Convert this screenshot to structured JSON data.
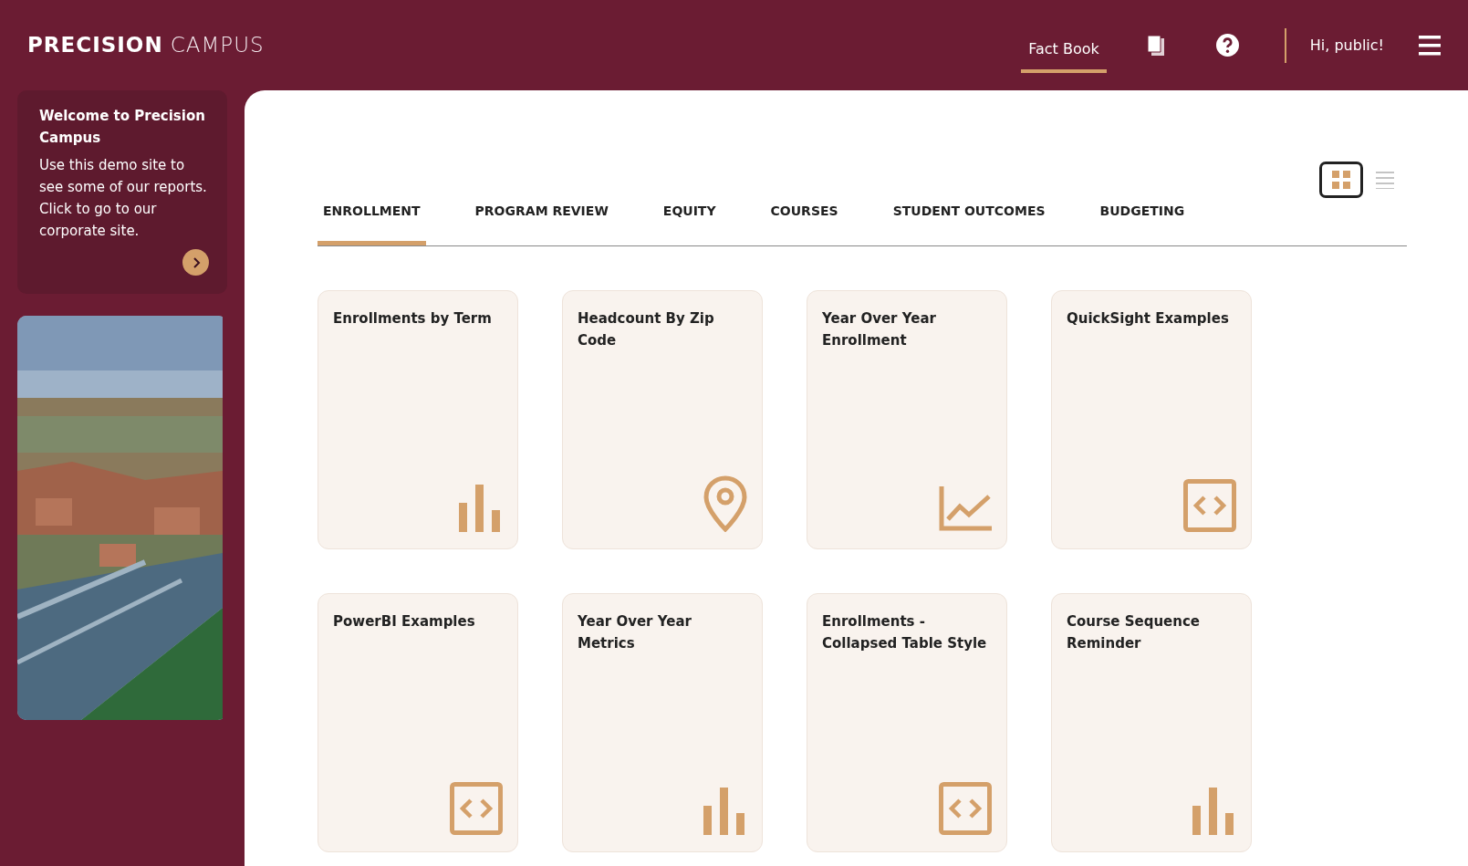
{
  "header": {
    "logo": {
      "bold": "PRECISION",
      "light": "CAMPUS"
    },
    "nav": [
      {
        "label": "Fact Book",
        "selected": true
      }
    ],
    "greeting": "Hi, public!"
  },
  "welcome": {
    "title": "Welcome to Precision Campus",
    "text": "Use this demo site to see some of our reports. Click to go to our corporate site."
  },
  "view_toggle": [
    {
      "kind": "grid",
      "selected": true
    },
    {
      "kind": "list",
      "selected": false
    }
  ],
  "tabs": [
    {
      "label": "ENROLLMENT",
      "selected": true
    },
    {
      "label": "PROGRAM REVIEW",
      "selected": false
    },
    {
      "label": "EQUITY",
      "selected": false
    },
    {
      "label": "COURSES",
      "selected": false
    },
    {
      "label": "STUDENT OUTCOMES",
      "selected": false
    },
    {
      "label": "BUDGETING",
      "selected": false
    }
  ],
  "cards": [
    {
      "title": "Enrollments by Term",
      "kind": "bar"
    },
    {
      "title": "Headcount By Zip Code",
      "kind": "pin"
    },
    {
      "title": "Year Over Year Enrollment",
      "kind": "line"
    },
    {
      "title": "QuickSight Examples",
      "kind": "code"
    },
    {
      "title": "PowerBI Examples",
      "kind": "code"
    },
    {
      "title": "Year Over Year Metrics",
      "kind": "bar"
    },
    {
      "title": "Enrollments - Collapsed Table Style",
      "kind": "code"
    },
    {
      "title": "Course Sequence Reminder",
      "kind": "bar"
    }
  ]
}
